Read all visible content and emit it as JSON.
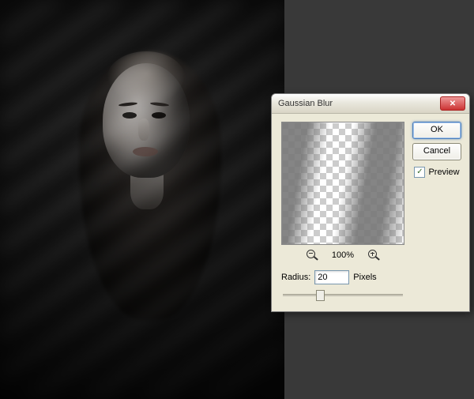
{
  "dialog": {
    "title": "Gaussian Blur",
    "ok": "OK",
    "cancel": "Cancel",
    "preview_label": "Preview",
    "preview_checked": "✓",
    "zoom": "100%",
    "radius_label": "Radius:",
    "radius_value": "20",
    "radius_unit": "Pixels"
  }
}
